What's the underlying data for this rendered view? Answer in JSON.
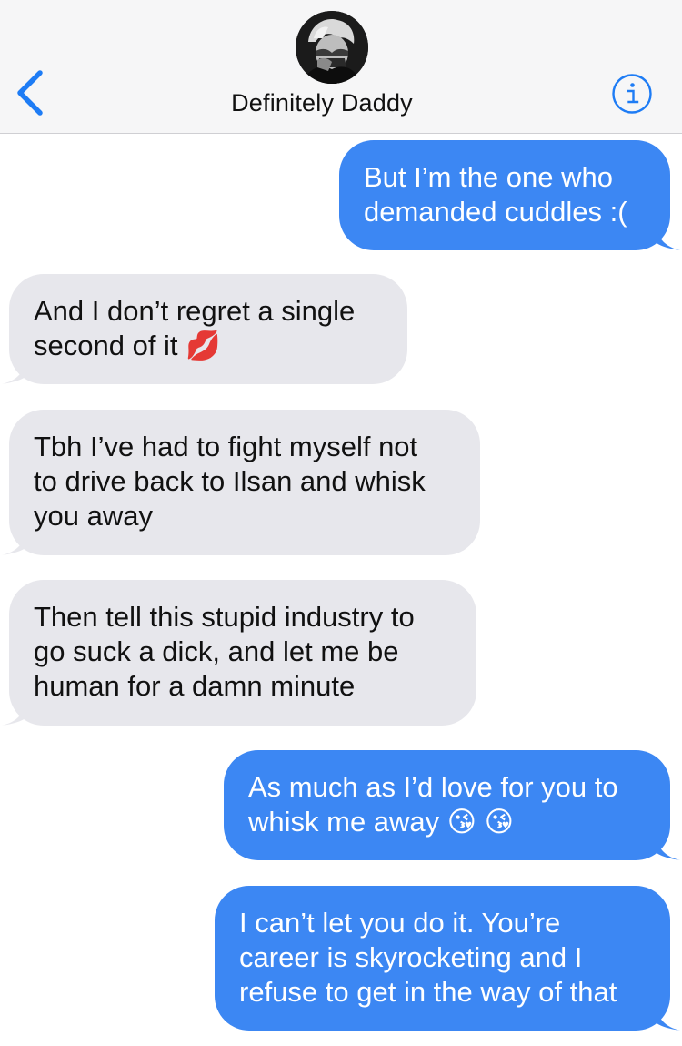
{
  "header": {
    "contact_name": "Definitely Daddy",
    "back_icon": "chevron-left-icon",
    "info_icon": "info-icon",
    "accent_color": "#1e7cf5",
    "background_color": "#f6f6f7"
  },
  "colors": {
    "outgoing_bubble": "#3c87f3",
    "incoming_bubble": "#e7e7ec"
  },
  "messages": [
    {
      "direction": "outgoing",
      "text": "But I’m the one who\ndemanded cuddles :("
    },
    {
      "direction": "incoming",
      "text": "And I don’t regret a single\nsecond of it 💋"
    },
    {
      "direction": "incoming",
      "text": "Tbh I’ve had to fight myself not\nto drive back to Ilsan and whisk\nyou away"
    },
    {
      "direction": "incoming",
      "text": "Then tell this stupid industry to\ngo suck a dick, and let me be\nhuman for a damn minute"
    },
    {
      "direction": "outgoing",
      "text": "As much as I’d love for you to\nwhisk me away 😘 😘"
    },
    {
      "direction": "outgoing",
      "text": "I can’t let you do it. You’re\ncareer is skyrocketing and I\nrefuse to get in the way of that"
    }
  ]
}
